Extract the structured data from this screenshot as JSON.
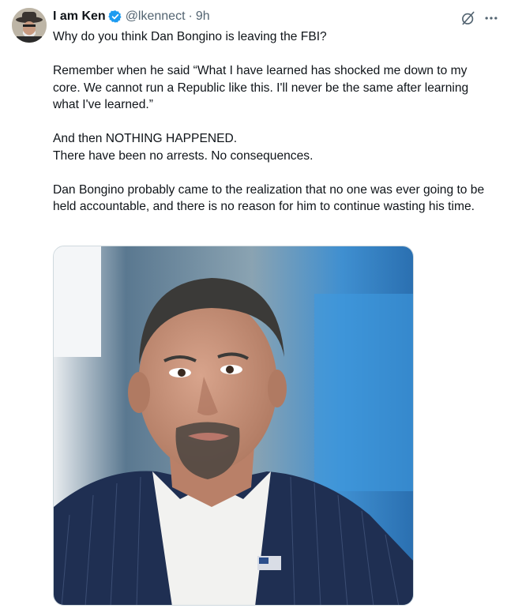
{
  "tweet": {
    "author_name": "I am Ken",
    "handle": "@lkennect",
    "separator": "·",
    "time": "9h",
    "verified": true,
    "paragraphs": [
      "Why do you think Dan Bongino is leaving the FBI?",
      "",
      "Remember when he said “What I have learned has shocked me down to my core. We cannot run a Republic like this. I'll never be the same after learning what I've learned.”",
      "",
      "And then NOTHING HAPPENED.",
      "There have been no arrests. No consequences.",
      "",
      "Dan Bongino probably came to the realization that no one was ever going to be held accountable, and there is no reason for him to continue wasting his time."
    ]
  },
  "icons": {
    "verified": "verified-badge-icon",
    "grok": "grok-icon",
    "more": "more-options-icon"
  },
  "colors": {
    "verified_blue": "#1d9bf0",
    "secondary_text": "#536471",
    "primary_text": "#0f1419"
  }
}
